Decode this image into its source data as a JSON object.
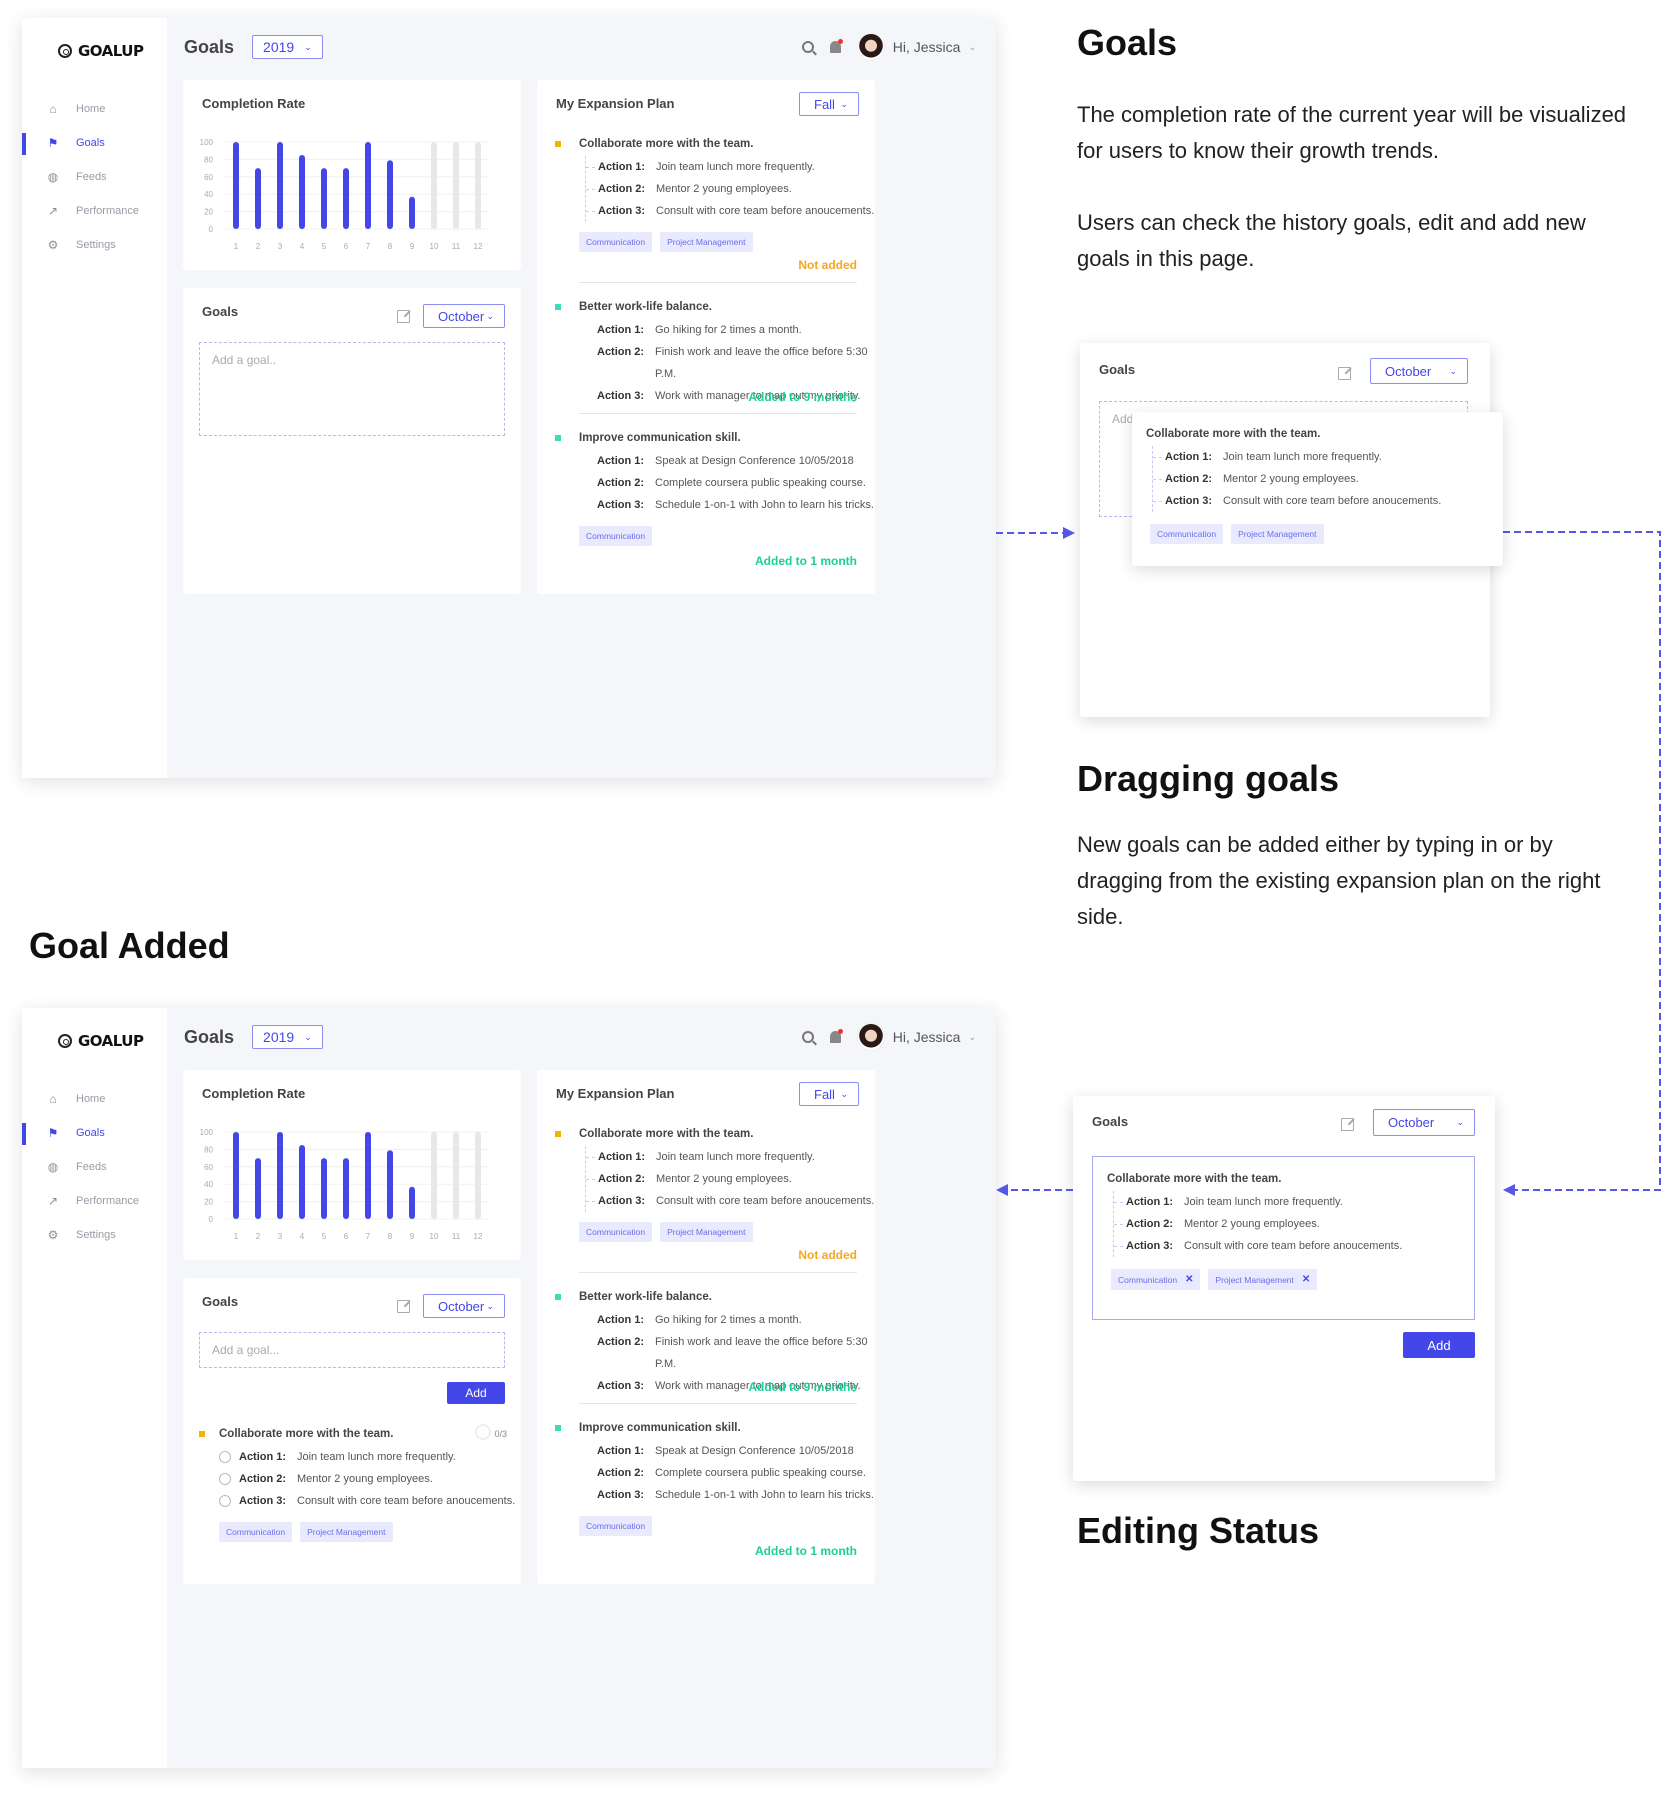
{
  "app": {
    "logo": "GOALUP",
    "nav": [
      {
        "label": "Home",
        "icon": "home-icon",
        "active": false
      },
      {
        "label": "Goals",
        "icon": "flag-icon",
        "active": true
      },
      {
        "label": "Feeds",
        "icon": "globe-icon",
        "active": false
      },
      {
        "label": "Performance",
        "icon": "chart-icon",
        "active": false
      },
      {
        "label": "Settings",
        "icon": "gear-icon",
        "active": false
      }
    ],
    "page_title": "Goals",
    "year": "2019",
    "greeting": "Hi, Jessica",
    "accent": "#4447e8"
  },
  "completion": {
    "title": "Completion Rate"
  },
  "chart_data": {
    "type": "bar",
    "title": "Completion Rate",
    "categories": [
      "1",
      "2",
      "3",
      "4",
      "5",
      "6",
      "7",
      "8",
      "9",
      "10",
      "11",
      "12"
    ],
    "values": [
      100,
      70,
      100,
      85,
      70,
      70,
      100,
      79,
      37,
      null,
      null,
      null
    ],
    "future_placeholder": 100,
    "yticks": [
      0,
      20,
      40,
      60,
      80,
      100
    ],
    "ylim": [
      0,
      100
    ],
    "xlabel": "",
    "ylabel": "",
    "grid": true,
    "colors": {
      "done": "#4447e8",
      "future": "#e8e8ea"
    }
  },
  "goals_card": {
    "title": "Goals",
    "month": "October",
    "placeholder_empty": "Add a goal..",
    "placeholder": "Add a goal...",
    "add_label": "Add"
  },
  "plan": {
    "title": "My Expansion Plan",
    "season": "Fall",
    "goals": [
      {
        "title": "Collaborate more with the team.",
        "color": "#f5b400",
        "actions": [
          [
            "Action 1:",
            "Join team lunch more frequently."
          ],
          [
            "Action 2:",
            "Mentor 2 young employees."
          ],
          [
            "Action 3:",
            "Consult with core team before anoucements."
          ]
        ],
        "tags": [
          "Communication",
          "Project Management"
        ],
        "status": "Not added",
        "status_color": "#f5a623"
      },
      {
        "title": "Better work-life balance.",
        "color": "#3ddbb8",
        "actions": [
          [
            "Action 1:",
            "Go hiking for 2 times a month."
          ],
          [
            "Action 2:",
            "Finish work and leave the office before 5:30 P.M."
          ],
          [
            "Action 3:",
            "Work with manager to map out my priority."
          ]
        ],
        "tags": [],
        "status": "Added to 9 months",
        "status_color": "#1ccf9a"
      },
      {
        "title": "Improve communication skill.",
        "color": "#3ddbb8",
        "actions": [
          [
            "Action 1:",
            "Speak at Design Conference 10/05/2018"
          ],
          [
            "Action 2:",
            "Complete coursera public speaking course."
          ],
          [
            "Action 3:",
            "Schedule 1-on-1 with John to learn his tricks."
          ]
        ],
        "tags": [
          "Communication"
        ],
        "status": "Added to 1 month",
        "status_color": "#1ccf9a"
      }
    ]
  },
  "added_goal": {
    "progress": "0/3"
  },
  "annotations": {
    "goals_heading": "Goals",
    "goals_p1": "The completion rate of the current year will be visualized for users to know their growth trends.",
    "goals_p2": "Users can check the history goals, edit and add new goals in this page.",
    "drag_heading": "Dragging goals",
    "drag_p": "New goals can be added either by typing in or by dragging from the existing expansion plan on the right side.",
    "added_heading": "Goal Added",
    "editing_heading": "Editing Status"
  }
}
